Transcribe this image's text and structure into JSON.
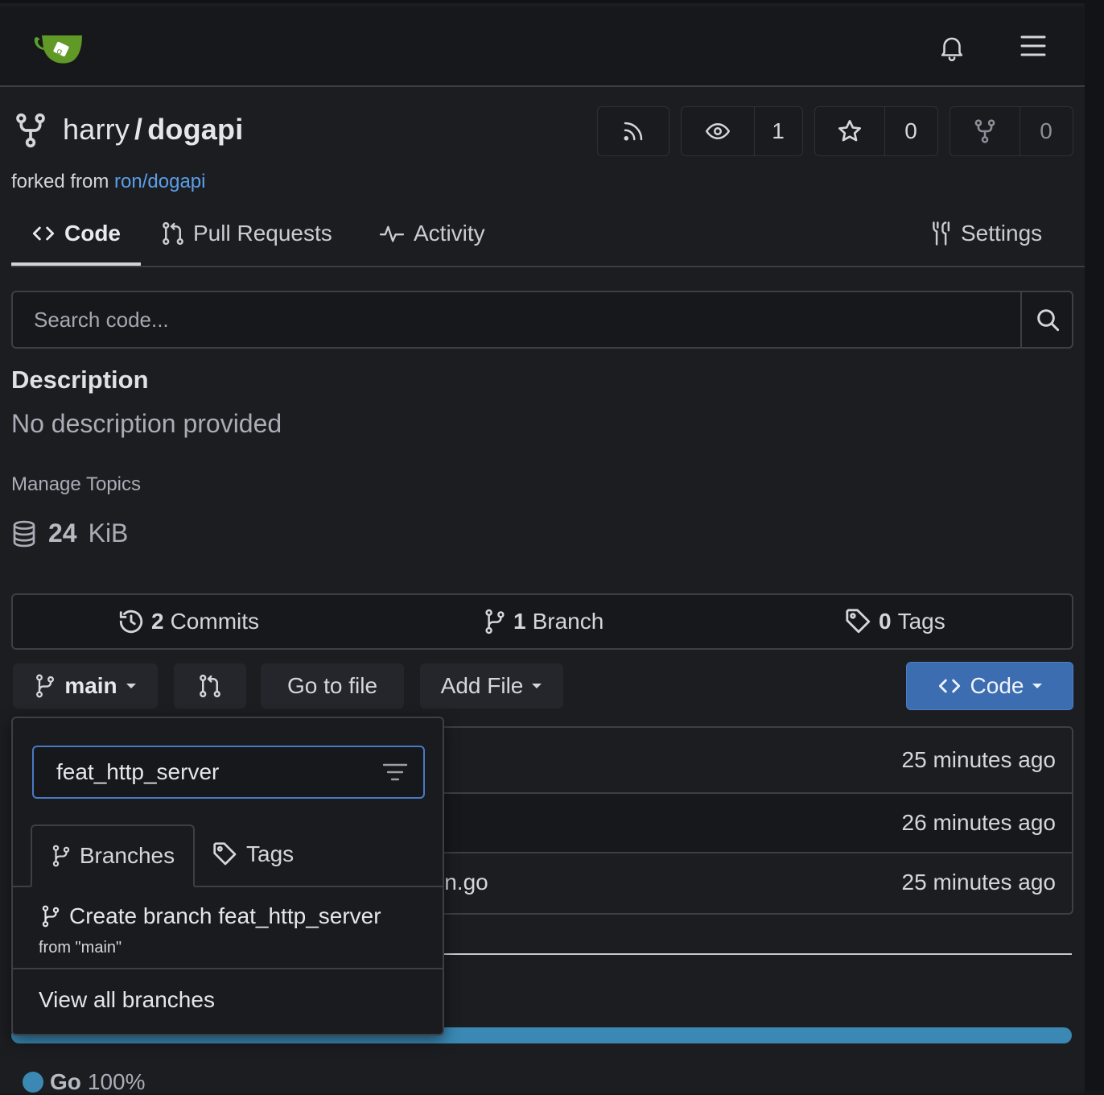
{
  "repo": {
    "owner": "harry",
    "separator": "/",
    "name": "dogapi",
    "forked_prefix": "forked from",
    "forked_link": "ron/dogapi",
    "watch_count": "1",
    "star_count": "0",
    "fork_count": "0"
  },
  "tabs": [
    {
      "label": "Code",
      "icon": "code-icon",
      "active": true
    },
    {
      "label": "Pull Requests",
      "icon": "pull-request-icon"
    },
    {
      "label": "Activity",
      "icon": "pulse-icon"
    },
    {
      "label": "Settings",
      "icon": "tools-icon"
    }
  ],
  "search": {
    "placeholder": "Search code..."
  },
  "description": {
    "heading": "Description",
    "text": "No description provided",
    "manage_topics": "Manage Topics",
    "size_value": "24",
    "size_unit": "KiB"
  },
  "stats": {
    "commits_count": "2",
    "commits_label": "Commits",
    "branches_count": "1",
    "branches_label": "Branch",
    "tags_count": "0",
    "tags_label": "Tags"
  },
  "toolbar": {
    "branch": "main",
    "go_to_file": "Go to file",
    "add_file": "Add File",
    "code": "Code"
  },
  "files": [
    {
      "name": "",
      "time": "25 minutes ago"
    },
    {
      "name": "",
      "time": "26 minutes ago"
    },
    {
      "name": "in.go",
      "time": "25 minutes ago"
    }
  ],
  "language": {
    "name": "Go",
    "percent": "100%",
    "color": "#3a88b3"
  },
  "dropdown": {
    "filter_value": "feat_http_server",
    "tab_branches": "Branches",
    "tab_tags": "Tags",
    "create_label": "Create branch feat_http_server",
    "create_from": "from \"main\"",
    "view_all": "View all branches"
  },
  "colors": {
    "accent": "#3d6db1",
    "link": "#5b9fe8",
    "background": "#1c1d21"
  }
}
